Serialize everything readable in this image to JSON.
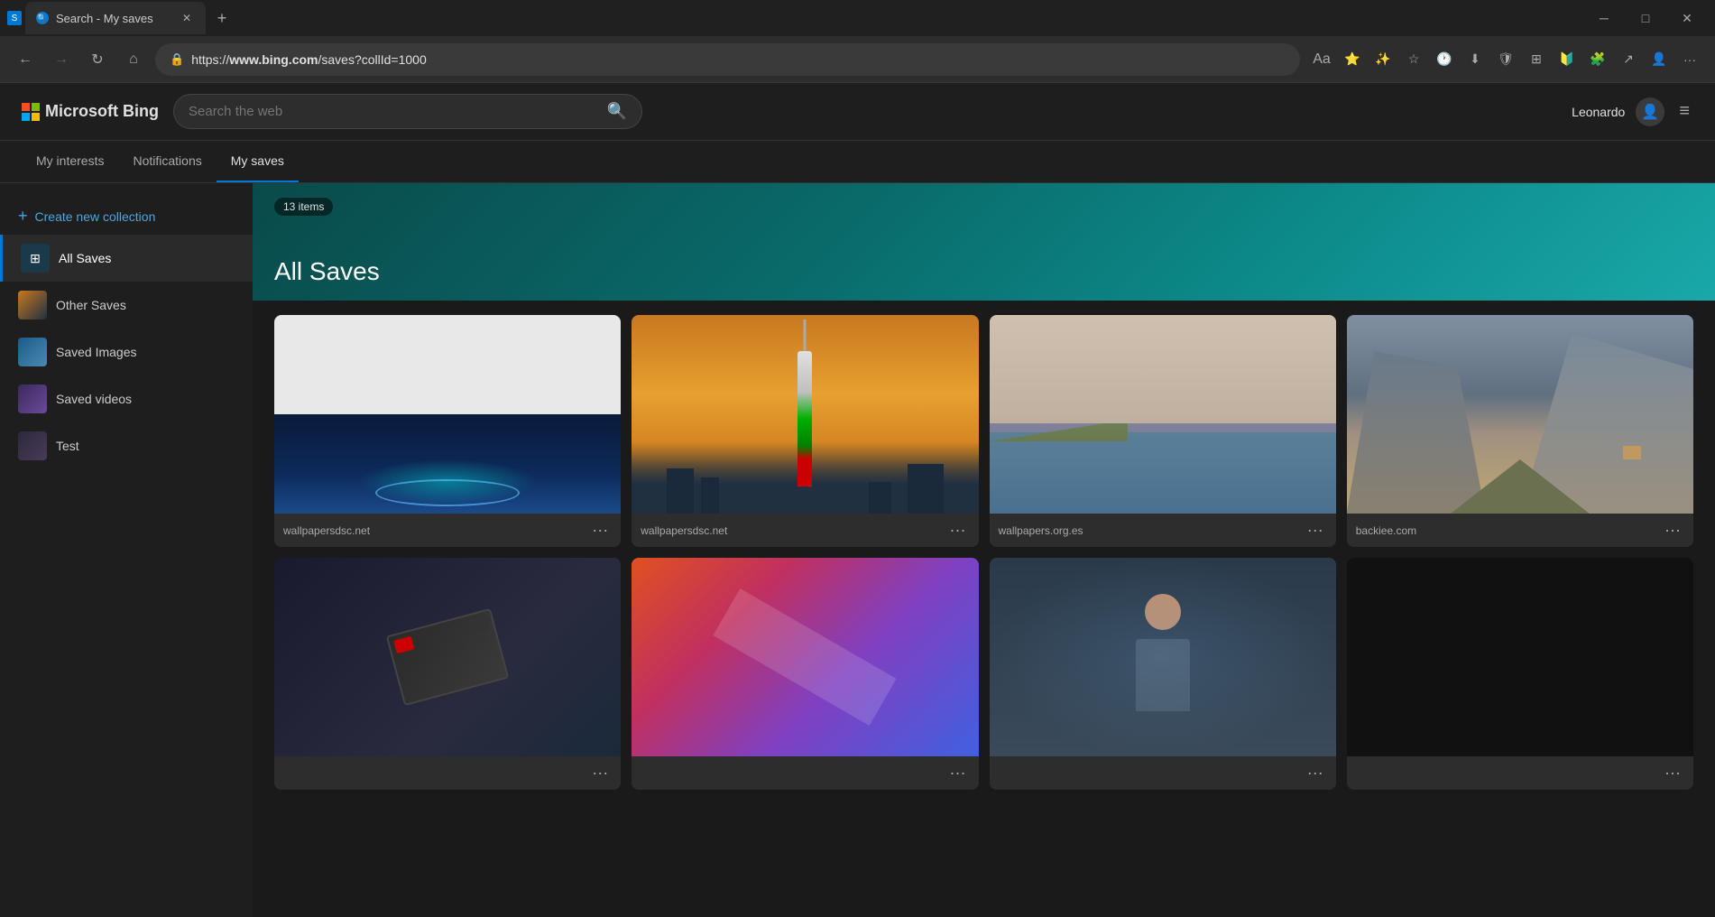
{
  "browser": {
    "tab": {
      "title": "Search - My saves",
      "favicon": "S",
      "url_display": "https://www.bing.com/saves?collId=1000",
      "url_prefix": "https://",
      "url_domain": "www.bing.com",
      "url_path": "/saves?collId=1000"
    },
    "window_controls": {
      "minimize": "─",
      "maximize": "□",
      "close": "✕"
    },
    "tab_new": "+",
    "nav": {
      "back": "←",
      "forward": "→",
      "refresh": "↻",
      "home": "⌂"
    }
  },
  "bing": {
    "logo_text": "Microsoft Bing",
    "search_placeholder": "Search the web",
    "user_name": "Leonardo",
    "nav_tabs": [
      {
        "id": "interests",
        "label": "My interests"
      },
      {
        "id": "notifications",
        "label": "Notifications"
      },
      {
        "id": "saves",
        "label": "My saves",
        "active": true
      }
    ]
  },
  "sidebar": {
    "create_label": "Create new collection",
    "items": [
      {
        "id": "all-saves",
        "label": "All Saves",
        "active": true,
        "icon": "grid"
      },
      {
        "id": "other-saves",
        "label": "Other Saves",
        "icon": "image"
      },
      {
        "id": "saved-images",
        "label": "Saved Images",
        "icon": "image"
      },
      {
        "id": "saved-videos",
        "label": "Saved videos",
        "icon": "video"
      },
      {
        "id": "test",
        "label": "Test",
        "icon": "image"
      }
    ]
  },
  "content": {
    "hero": {
      "items_count": "13 items",
      "title": "All Saves"
    },
    "cards": [
      {
        "id": "card-1",
        "source": "wallpapersdsc.net",
        "type": "composite",
        "more": "···"
      },
      {
        "id": "card-2",
        "source": "wallpapersdsc.net",
        "type": "tower",
        "more": "···"
      },
      {
        "id": "card-3",
        "source": "wallpapers.org.es",
        "type": "coastal",
        "more": "···"
      },
      {
        "id": "card-4",
        "source": "backiee.com",
        "type": "meteora",
        "more": "···"
      }
    ],
    "bottom_cards": [
      {
        "id": "card-5",
        "source": "",
        "type": "tech1"
      },
      {
        "id": "card-6",
        "source": "",
        "type": "colorful"
      },
      {
        "id": "card-7",
        "source": "",
        "type": "person"
      },
      {
        "id": "card-8",
        "source": "",
        "type": "dark"
      }
    ]
  }
}
